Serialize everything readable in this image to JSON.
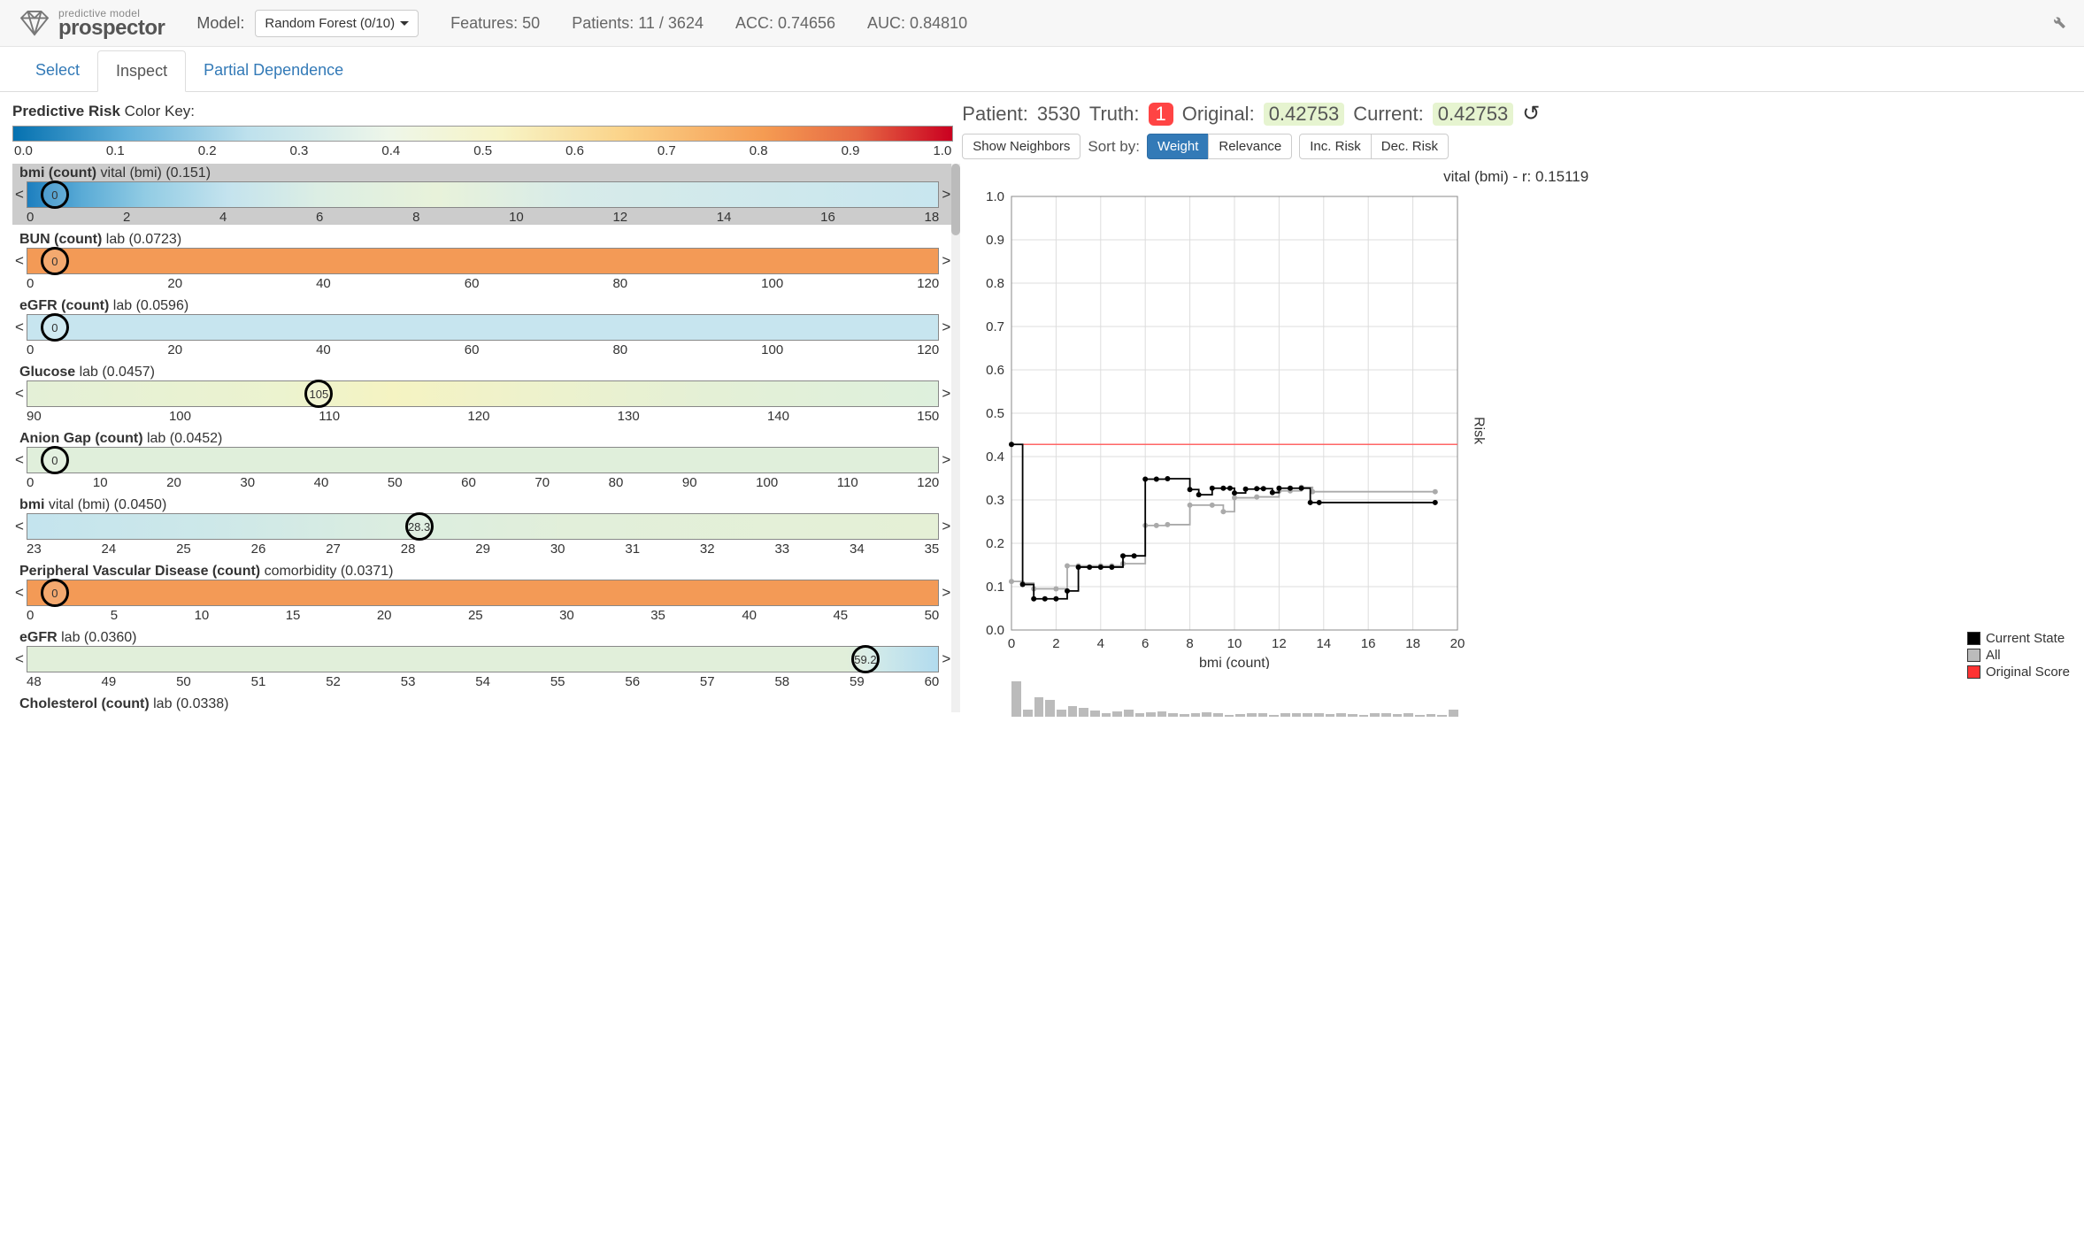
{
  "app": {
    "brand_sub": "predictive model",
    "brand_main": "prospector"
  },
  "header": {
    "model_label": "Model:",
    "model_value": "Random Forest (0/10)",
    "features": "Features: 50",
    "patients": "Patients: 11 / 3624",
    "acc": "ACC: 0.74656",
    "auc": "AUC: 0.84810"
  },
  "tabs": {
    "select": "Select",
    "inspect": "Inspect",
    "partial": "Partial Dependence"
  },
  "colorkey": {
    "label_bold": "Predictive Risk",
    "label_rest": " Color Key:",
    "ticks": [
      "0.0",
      "0.1",
      "0.2",
      "0.3",
      "0.4",
      "0.5",
      "0.6",
      "0.7",
      "0.8",
      "0.9",
      "1.0"
    ]
  },
  "features": [
    {
      "name": "bmi (count)",
      "cat": "vital (bmi)",
      "w": "(0.151)",
      "value": "0",
      "pos": 3,
      "ticks": [
        "0",
        "2",
        "4",
        "6",
        "8",
        "10",
        "12",
        "14",
        "16",
        "18"
      ],
      "gradient": "linear-gradient(to right,#1d7fbf 0%, #5aabd6 6%, #92cce4 13%, #c4e3ee 22%, #dceee4 32%, #e8f2da 45%, #d7ebe9 60%, #c8e6ef 100%)",
      "selected": true
    },
    {
      "name": "BUN (count)",
      "cat": "lab",
      "w": "(0.0723)",
      "value": "0",
      "pos": 3,
      "ticks": [
        "0",
        "20",
        "40",
        "60",
        "80",
        "100",
        "120"
      ],
      "gradient": "linear-gradient(to right,#f39a56 0%, #f39a56 100%)"
    },
    {
      "name": "eGFR (count)",
      "cat": "lab",
      "w": "(0.0596)",
      "value": "0",
      "pos": 3,
      "ticks": [
        "0",
        "20",
        "40",
        "60",
        "80",
        "100",
        "120"
      ],
      "gradient": "linear-gradient(to right,#c7e5ef 0%, #c7e5ef 100%)"
    },
    {
      "name": "Glucose",
      "cat": "lab",
      "w": "(0.0457)",
      "value": "105",
      "pos": 32,
      "ticks": [
        "90",
        "100",
        "110",
        "120",
        "130",
        "140",
        "150"
      ],
      "gradient": "linear-gradient(to right,#e4f0d7 0%, #ecf3cf 28%, #f5f3c2 40%, #eef2cc 55%, #e4f0d6 75%, #def0dd 100%)"
    },
    {
      "name": "Anion Gap (count)",
      "cat": "lab",
      "w": "(0.0452)",
      "value": "0",
      "pos": 3,
      "ticks": [
        "0",
        "10",
        "20",
        "30",
        "40",
        "50",
        "60",
        "70",
        "80",
        "90",
        "100",
        "110",
        "120"
      ],
      "gradient": "linear-gradient(to right,#e0efdb 0%, #e0efdb 100%)"
    },
    {
      "name": "bmi",
      "cat": "vital (bmi)",
      "w": "(0.0450)",
      "value": "28.3",
      "pos": 43,
      "ticks": [
        "23",
        "24",
        "25",
        "26",
        "27",
        "28",
        "29",
        "30",
        "31",
        "32",
        "33",
        "34",
        "35"
      ],
      "gradient": "linear-gradient(to right,#c4e4ee 0%, #cde8e9 20%, #dbede0 40%, #e2efda 60%, #e5f0d6 100%)"
    },
    {
      "name": "Peripheral Vascular Disease (count)",
      "cat": "comorbidity",
      "w": "(0.0371)",
      "value": "0",
      "pos": 3,
      "ticks": [
        "0",
        "5",
        "10",
        "15",
        "20",
        "25",
        "30",
        "35",
        "40",
        "45",
        "50"
      ],
      "gradient": "linear-gradient(to right,#f39a56 0%, #f39a56 100%)"
    },
    {
      "name": "eGFR",
      "cat": "lab",
      "w": "(0.0360)",
      "value": "59.2",
      "pos": 92,
      "ticks": [
        "48",
        "49",
        "50",
        "51",
        "52",
        "53",
        "54",
        "55",
        "56",
        "57",
        "58",
        "59",
        "60"
      ],
      "gradient": "linear-gradient(to right,#e1efda 0%, #e1efda 90%, #cde8ea 94%, #b2dbee 100%)"
    },
    {
      "name": "Cholesterol (count)",
      "cat": "lab",
      "w": "(0.0338)",
      "value": "",
      "pos": 0,
      "ticks": [],
      "gradient": "",
      "cut": true
    }
  ],
  "patient": {
    "id_label": "Patient:",
    "id": "3530",
    "truth_label": "Truth:",
    "truth": "1",
    "orig_label": "Original:",
    "orig": "0.42753",
    "cur_label": "Current:",
    "cur": "0.42753"
  },
  "controls": {
    "neighbors": "Show Neighbors",
    "sortby": "Sort by:",
    "weight": "Weight",
    "relevance": "Relevance",
    "inc": "Inc. Risk",
    "dec": "Dec. Risk"
  },
  "chart": {
    "title": "vital (bmi) - r: 0.15119",
    "xlabel": "bmi (count)",
    "ylabel": "Risk",
    "yticks": [
      "0.0",
      "0.1",
      "0.2",
      "0.3",
      "0.4",
      "0.5",
      "0.6",
      "0.7",
      "0.8",
      "0.9",
      "1.0"
    ],
    "xticks": [
      "0",
      "2",
      "4",
      "6",
      "8",
      "10",
      "12",
      "14",
      "16",
      "18",
      "20"
    ],
    "legend": [
      {
        "label": "Current State",
        "color": "#000"
      },
      {
        "label": "All",
        "color": "#bbb"
      },
      {
        "label": "Original Score",
        "color": "#f33"
      }
    ]
  },
  "chart_data": {
    "type": "line",
    "xlabel": "bmi (count)",
    "ylabel": "Risk",
    "xlim": [
      0,
      20
    ],
    "ylim": [
      0,
      1
    ],
    "original_score": 0.428,
    "series": [
      {
        "name": "Current State",
        "x": [
          0,
          0.5,
          1,
          1.5,
          2,
          2.5,
          3,
          3.5,
          4,
          4.5,
          5,
          5.5,
          6,
          6.5,
          7,
          8,
          8.4,
          9,
          9.5,
          9.8,
          10,
          10.5,
          11,
          11.3,
          11.7,
          12,
          12.5,
          13,
          13.4,
          13.8,
          19
        ],
        "y": [
          0.428,
          0.105,
          0.072,
          0.072,
          0.072,
          0.09,
          0.145,
          0.145,
          0.145,
          0.145,
          0.171,
          0.171,
          0.348,
          0.348,
          0.349,
          0.324,
          0.312,
          0.327,
          0.327,
          0.327,
          0.316,
          0.325,
          0.326,
          0.326,
          0.317,
          0.327,
          0.327,
          0.327,
          0.294,
          0.294,
          0.294
        ]
      },
      {
        "name": "All",
        "x": [
          0,
          0.5,
          1,
          2,
          2.5,
          3,
          4,
          4.5,
          5,
          6,
          6.5,
          7,
          8,
          9,
          9.5,
          10,
          11,
          12,
          12.5,
          13,
          13.5,
          19
        ],
        "y": [
          0.112,
          0.108,
          0.095,
          0.095,
          0.148,
          0.148,
          0.148,
          0.148,
          0.153,
          0.241,
          0.241,
          0.243,
          0.288,
          0.288,
          0.273,
          0.305,
          0.307,
          0.321,
          0.321,
          0.329,
          0.319,
          0.319
        ]
      }
    ],
    "histogram": {
      "x_bins": 40,
      "heights_relative": [
        1.0,
        0.22,
        0.55,
        0.48,
        0.2,
        0.3,
        0.25,
        0.18,
        0.1,
        0.15,
        0.22,
        0.12,
        0.14,
        0.16,
        0.1,
        0.08,
        0.11,
        0.13,
        0.1,
        0.06,
        0.09,
        0.12,
        0.1,
        0.07,
        0.1,
        0.12,
        0.11,
        0.1,
        0.09,
        0.1,
        0.08,
        0.07,
        0.1,
        0.12,
        0.09,
        0.1,
        0.06,
        0.08,
        0.07,
        0.22
      ]
    }
  }
}
